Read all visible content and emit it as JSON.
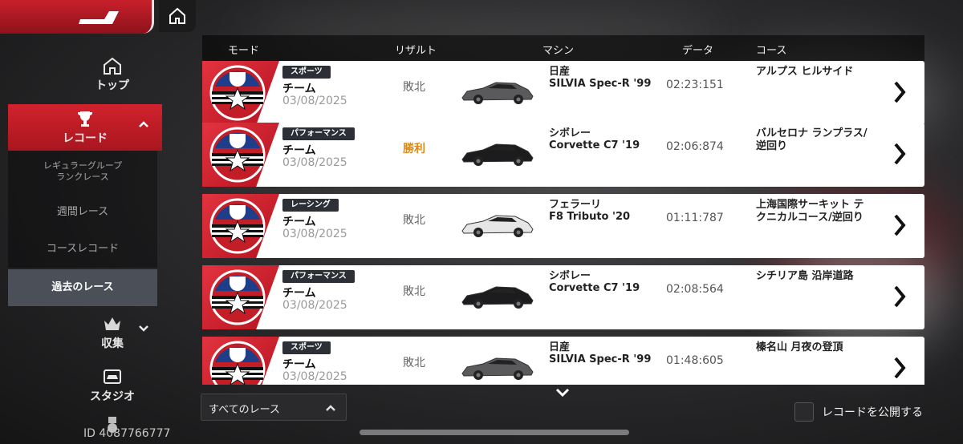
{
  "header": {
    "home_icon": "home-icon",
    "logo_icon": "brand-logo"
  },
  "sidebar": {
    "top_label": "トップ",
    "record_label": "レコード",
    "sub_regular": "レギュラーグループ\nランクレース",
    "sub_weekly": "週間レース",
    "sub_course": "コースレコード",
    "sub_past": "過去のレース",
    "collect_label": "収集",
    "studio_label": "スタジオ",
    "player_id": "ID 4087766777"
  },
  "columns": {
    "mode": "モード",
    "result": "リザルト",
    "machine": "マシン",
    "data": "データ",
    "course": "コース"
  },
  "rows": [
    {
      "badge": "スポーツ",
      "team": "チーム",
      "date": "03/08/2025",
      "result": "敗北",
      "win": false,
      "maker": "日産",
      "model": "SILVIA Spec-R '99",
      "time": "02:23:151",
      "course": "アルプス ヒルサイド",
      "car_color": "#5a5a5c"
    },
    {
      "badge": "パフォーマンス",
      "team": "チーム",
      "date": "03/08/2025",
      "result": "勝利",
      "win": true,
      "maker": "シボレー",
      "model": "Corvette C7 '19",
      "time": "02:06:874",
      "course": "バルセロナ ランプラス/逆回り",
      "car_color": "#1c1c1e"
    },
    {
      "badge": "レーシング",
      "team": "チーム",
      "date": "03/08/2025",
      "result": "敗北",
      "win": false,
      "maker": "フェラーリ",
      "model": "F8 Tributo  '20",
      "time": "01:11:787",
      "course": "上海国際サーキット テクニカルコース/逆回り",
      "car_color": "#e6e6e6"
    },
    {
      "badge": "パフォーマンス",
      "team": "チーム",
      "date": "03/08/2025",
      "result": "敗北",
      "win": false,
      "maker": "シボレー",
      "model": "Corvette C7 '19",
      "time": "02:08:564",
      "course": "シチリア島 沿岸道路",
      "car_color": "#1c1c1e"
    },
    {
      "badge": "スポーツ",
      "team": "チーム",
      "date": "03/08/2025",
      "result": "敗北",
      "win": false,
      "maker": "日産",
      "model": "SILVIA Spec-R '99",
      "time": "01:48:605",
      "course": "榛名山 月夜の登頂",
      "car_color": "#5a5a5c"
    }
  ],
  "filter": {
    "selected": "すべてのレース"
  },
  "publish": {
    "label": "レコードを公開する",
    "checked": false
  },
  "colors": {
    "accent_red": "#c8202b",
    "win_orange": "#d98a1a"
  }
}
